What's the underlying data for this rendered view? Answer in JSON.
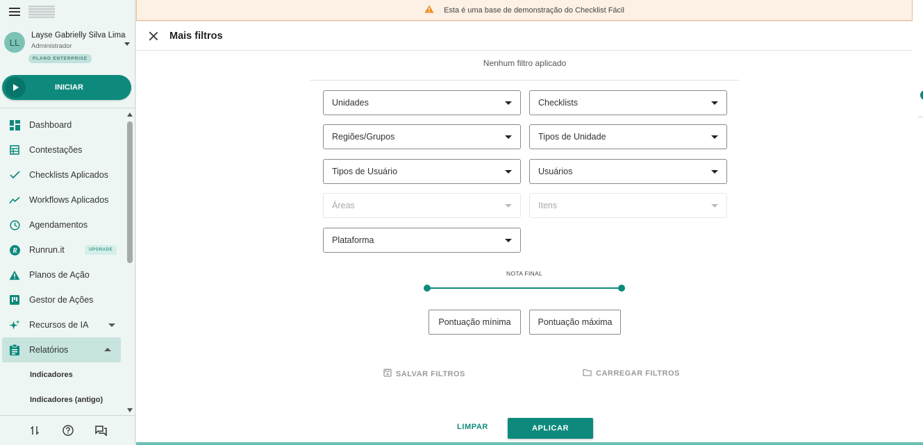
{
  "banner": {
    "text": "Esta é uma base de demonstração do Checklist Fácil",
    "icon": "warning-icon"
  },
  "user": {
    "initials": "LL",
    "name": "Layse Gabrielly Silva Lima",
    "role": "Administrador",
    "plan": "PLANO ENTERPRISE"
  },
  "start_button": {
    "label": "INICIAR"
  },
  "nav": {
    "items": [
      {
        "label": "Dashboard",
        "icon": "dashboard-icon"
      },
      {
        "label": "Contestações",
        "icon": "table-icon"
      },
      {
        "label": "Checklists Aplicados",
        "icon": "check-icon"
      },
      {
        "label": "Workflows Aplicados",
        "icon": "trend-icon"
      },
      {
        "label": "Agendamentos",
        "icon": "clock-icon"
      },
      {
        "label": "Runrun.it",
        "icon": "runrun-icon",
        "badge": "UPGRADE"
      },
      {
        "label": "Planos de Ação",
        "icon": "alert-icon"
      },
      {
        "label": "Gestor de Ações",
        "icon": "kanban-icon"
      },
      {
        "label": "Recursos de IA",
        "icon": "sparkle-icon"
      },
      {
        "label": "Relatórios",
        "icon": "clipboard-icon"
      }
    ],
    "sub_items": [
      "Indicadores",
      "Indicadores (antigo)"
    ]
  },
  "panel": {
    "title": "Mais filtros",
    "no_filter": "Nenhum filtro aplicado",
    "filters": {
      "unidades": "Unidades",
      "checklists": "Checklists",
      "regioes": "Regiões/Grupos",
      "tipos_unidade": "Tipos de Unidade",
      "tipos_usuario": "Tipos de Usuário",
      "usuarios": "Usuários",
      "areas": "Áreas",
      "itens": "Itens",
      "plataforma": "Plataforma"
    },
    "nota_final": "NOTA FINAL",
    "slider": {
      "min_fraction": 0,
      "max_fraction": 1
    },
    "min_score": "Pontuação mínima",
    "max_score": "Pontuação máxima",
    "save_filters": "SALVAR FILTROS",
    "load_filters": "CARREGAR FILTROS",
    "clear": "LIMPAR",
    "apply": "APLICAR"
  },
  "colors": {
    "accent": "#0d8a7c",
    "banner_bg": "#fdf0e4",
    "banner_border": "#efb98c",
    "warning": "#f08c1e"
  }
}
